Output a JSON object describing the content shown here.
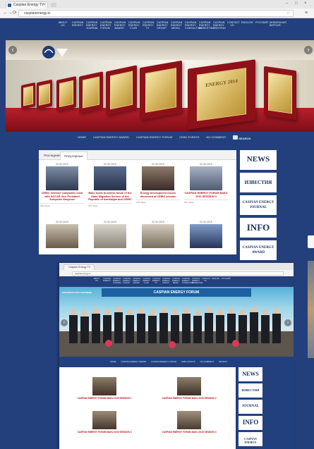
{
  "browser": {
    "tab_title": "Caspian Energy TV",
    "url": "caspianenergy.tv",
    "close_glyph": "×",
    "window_controls": [
      "–",
      "□",
      "×"
    ],
    "nav": [
      "←",
      "→",
      "⟳"
    ],
    "menu_glyph": "≡",
    "star_glyph": "☆"
  },
  "header": {
    "top_nav": [
      "ABOUT US",
      "CASPIAN ENERGY",
      "CASPIAN ENERGY JOURNAL",
      "CASPIAN ENERGY FORUM",
      "CASPIAN ENERGY AWARD",
      "CASPIAN ENERGY CLUB",
      "CASPIAN ENERGY TV",
      "CASPIAN ENERGY GROUP",
      "CASPIAN ENERGY MEDIA",
      "CASPIAN ENERGY CONSULTING",
      "CASPIAN ENERGY MARKETING",
      "CASPIAN ENERGY PRINTING",
      "CONTACT US",
      "ENGLISH",
      "РУССКИЙ",
      "МОБИЛЬНАЯ ВЕРСИЯ"
    ]
  },
  "hero": {
    "plaque_label": "ENERGY 2014",
    "prev_glyph": "‹",
    "next_glyph": "›"
  },
  "sub_nav": {
    "items": [
      "HOME",
      "CASPIAN ENERGY AWARD",
      "CASPIAN ENERGY FORUM",
      "CEBC EVENTS",
      "NO COMMENT"
    ],
    "search_label": "SEARCH"
  },
  "panel": {
    "tabs": [
      "Последние",
      "Популярные"
    ],
    "cards": [
      {
        "date": "02.09.2015",
        "title": "CEIBC member companies meet with SOCAR Vice President Suleyman Gasymov",
        "meta": "266 Views"
      },
      {
        "date": "02.09.2015",
        "title": "Baku hosts business forum of the State Migration Service of the Republic of Azerbaijan and CEIBC",
        "meta": "312 Views"
      },
      {
        "date": "02.09.2015",
        "title": "Energy development issues discussed at CEIBC session",
        "meta": "178 Views"
      },
      {
        "date": "02.09.2015",
        "title": "CASPIAN ENERGY FORUM BAKU 2015 SESSION 3",
        "meta": "541 Views"
      }
    ],
    "cards_row2_dates": [
      "02.09.2015",
      "02.09.2015",
      "02.09.2015",
      "02.09.2015"
    ]
  },
  "logos": [
    "NEWS",
    "ИЗВЕСТИЯ",
    "CASPIAN ENERGY JOURNAL",
    "INFO",
    "CASPIAN ENERGY AWARD"
  ],
  "second_window": {
    "tab_title": "Caspian Energy TV",
    "url": "caspianenergy.tv",
    "top_nav": [
      "ABOUT US",
      "CASPIAN ENERGY",
      "CASPIAN ENERGY JOURNAL",
      "CASPIAN ENERGY FORUM",
      "CASPIAN ENERGY AWARD",
      "CASPIAN ENERGY CLUB",
      "CASPIAN ENERGY TV",
      "CASPIAN ENERGY GROUP",
      "CASPIAN ENERGY MEDIA",
      "CASPIAN ENERGY CONSULTING",
      "CASPIAN ENERGY MARKETING",
      "CONTACT US",
      "ENGLISH",
      "РУССКИЙ"
    ],
    "banner_text": "CASPIAN ENERGY FORUM",
    "partner_text": "EUROPEAN-ASIA PARTNERS",
    "sub_nav": [
      "HOME",
      "CASPIAN ENERGY AWARD",
      "CASPIAN ENERGY FORUM",
      "CEBC EVENTS",
      "NO COMMENT",
      "SEARCH"
    ],
    "cards": [
      {
        "title": "CASPIAN ENERGY FORUM BAKU 2015 SESSION 1"
      },
      {
        "title": "CASPIAN ENERGY FORUM BAKU 2015 SESSION 2"
      },
      {
        "title": "CASPIAN ENERGY FORUM BAKU 2015 SESSION 3"
      },
      {
        "title": "CASPIAN ENERGY FORUM BAKU 2015 SESSION 4"
      }
    ],
    "logos": [
      "NEWS",
      "ИЗВЕСТИЯ",
      "JOURNAL",
      "INFO",
      "CASPIAN ENERGY"
    ]
  },
  "colors": {
    "page_background": "#23407d",
    "accent_red": "#b2131c",
    "plaque_red": "#8e1119"
  }
}
